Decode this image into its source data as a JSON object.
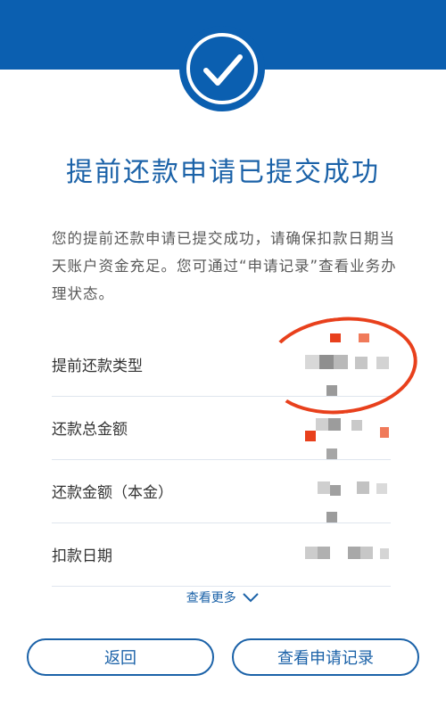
{
  "header": {
    "icon": "check-circle-icon",
    "brand_color": "#0b5fb0"
  },
  "title": "提前还款申请已提交成功",
  "description": "您的提前还款申请已提交成功，请确保扣款日期当天账户资金充足。您可通过“申请记录”查看业务办理状态。",
  "details": {
    "rows": [
      {
        "label": "提前还款类型"
      },
      {
        "label": "还款总金额"
      },
      {
        "label": "还款金额（本金）"
      },
      {
        "label": "扣款日期"
      }
    ]
  },
  "more": {
    "label": "查看更多",
    "icon": "chevron-down-icon"
  },
  "buttons": {
    "back": "返回",
    "records": "查看申请记录"
  },
  "colors": {
    "accent": "#1b62a8",
    "annotation": "#e8401c"
  }
}
